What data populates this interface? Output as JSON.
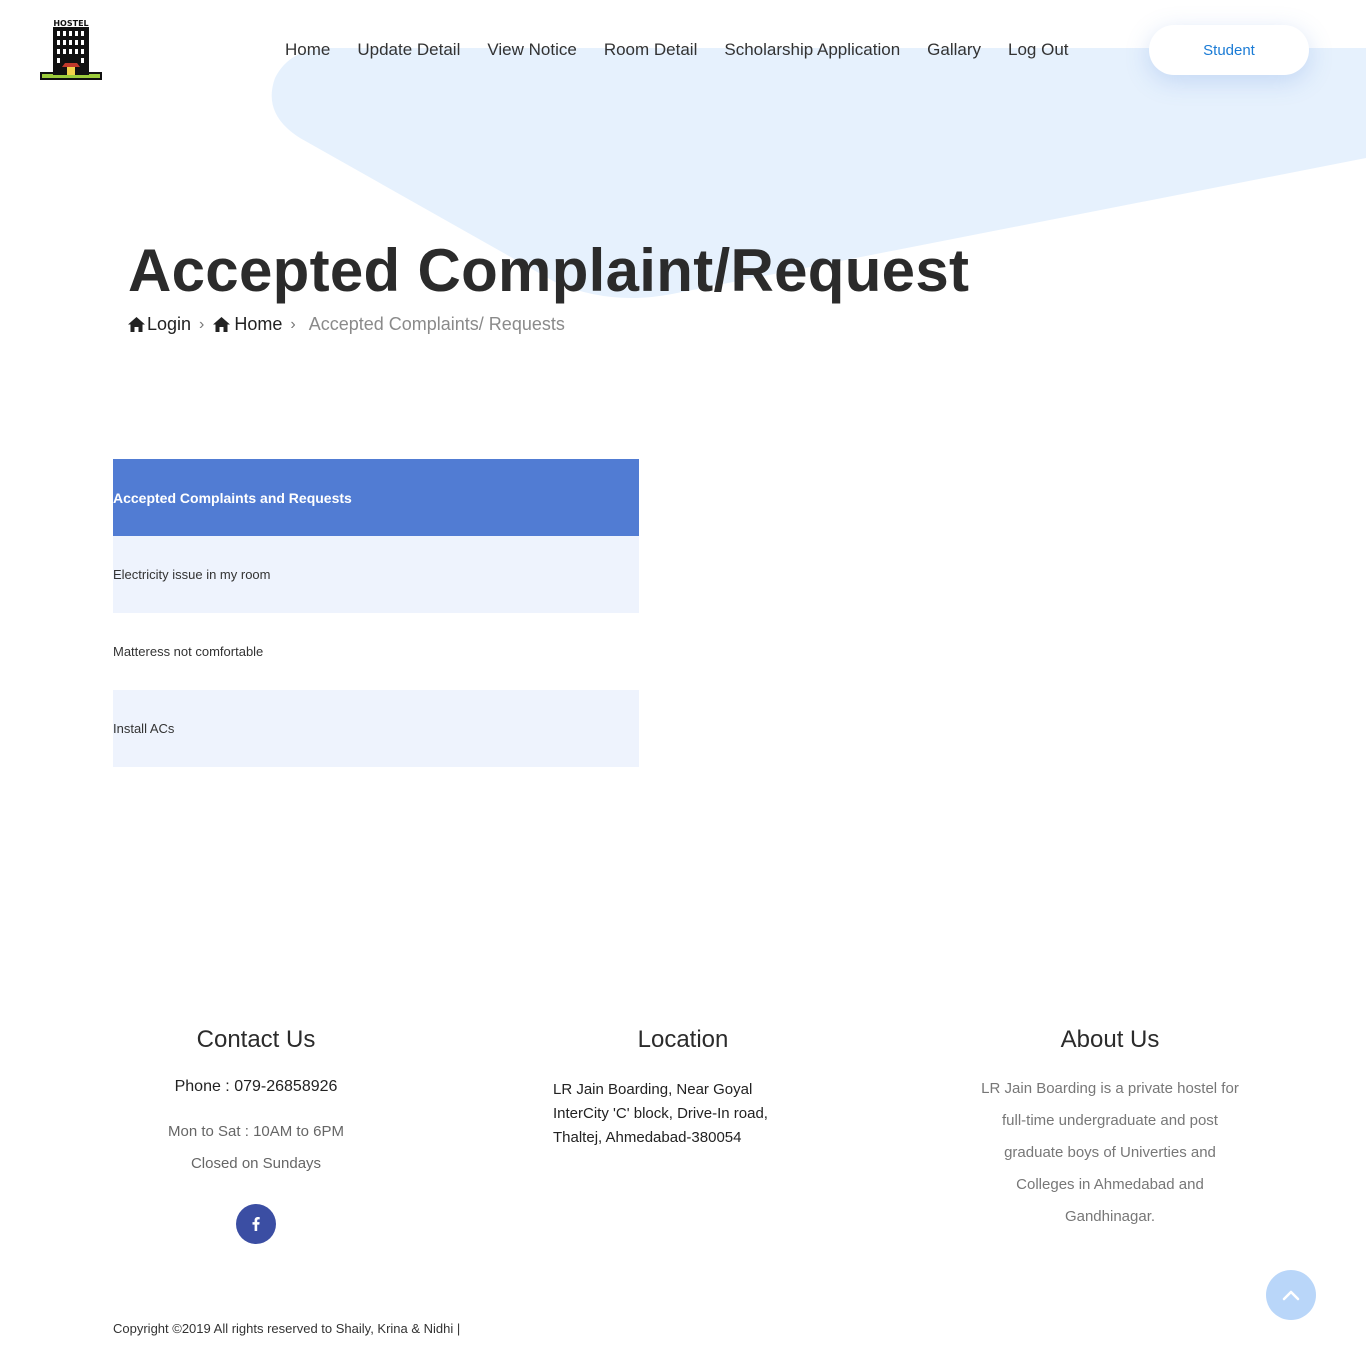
{
  "brand": {
    "logo_text": "HOSTEL",
    "icon": "hostel-building-icon"
  },
  "nav": {
    "items": [
      "Home",
      "Update Detail",
      "View Notice",
      "Room Detail",
      "Scholarship Application",
      "Gallary",
      "Log Out"
    ],
    "student_button": "Student"
  },
  "page": {
    "title": "Accepted Complaint/Request"
  },
  "breadcrumb": {
    "login": "Login",
    "home": "Home",
    "current": "Accepted Complaints/ Requests",
    "home_icon": "home-icon",
    "separator_icon": "chevron-right-icon"
  },
  "table": {
    "header": "Accepted Complaints and Requests",
    "rows": [
      "Electricity issue in my room",
      "Matteress not comfortable",
      "Install ACs"
    ]
  },
  "footer": {
    "contact": {
      "title": "Contact Us",
      "phone": "Phone : 079-26858926",
      "hours": "Mon to Sat : 10AM to 6PM",
      "closed": "Closed on Sundays",
      "social_icon": "facebook-icon"
    },
    "location": {
      "title": "Location",
      "line1": "LR Jain Boarding, Near Goyal",
      "line2": "InterCity 'C' block, Drive-In road,",
      "line3": "Thaltej, Ahmedabad-380054"
    },
    "about": {
      "title": "About Us",
      "text": "LR Jain Boarding is a private hostel for full-time undergraduate and post graduate boys of Univerties and Colleges in Ahmedabad and Gandhinagar."
    },
    "copyright": "Copyright ©2019 All rights reserved to Shaily, Krina & Nidhi |"
  },
  "colors": {
    "accent_blue": "#517cd3",
    "student_text": "#1a7bd5",
    "blob": "#e6f1fd",
    "row_alt": "#eef3fd",
    "facebook": "#3b4ea3",
    "scroll_top": "#b9d6f9"
  },
  "scroll_top_icon": "chevron-up-icon"
}
